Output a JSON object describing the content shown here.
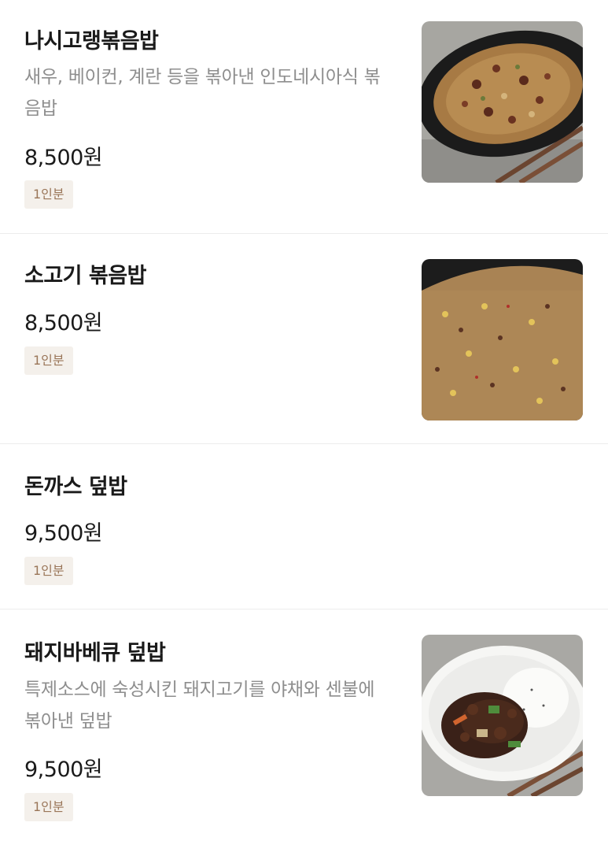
{
  "menu": {
    "items": [
      {
        "name": "나시고랭볶음밥",
        "description": "새우, 베이컨, 계란 등을 볶아낸 인도네시아식 볶음밥",
        "price": "8,500원",
        "badge": "1인분",
        "image": "nasi-goreng-photo"
      },
      {
        "name": "소고기 볶음밥",
        "price": "8,500원",
        "badge": "1인분",
        "image": "beef-fried-rice-photo"
      },
      {
        "name": "돈까스 덮밥",
        "price": "9,500원",
        "badge": "1인분"
      },
      {
        "name": "돼지바베큐 덮밥",
        "description": "특제소스에 숙성시킨 돼지고기를 야채와 센불에 볶아낸 덮밥",
        "price": "9,500원",
        "badge": "1인분",
        "image": "pork-bbq-rice-bowl-photo"
      }
    ]
  },
  "colors": {
    "name_text": "#1a1a1a",
    "description_text": "#8e8e8e",
    "badge_bg": "#f4f0eb",
    "badge_text": "#9a7659",
    "divider": "#ececec"
  }
}
